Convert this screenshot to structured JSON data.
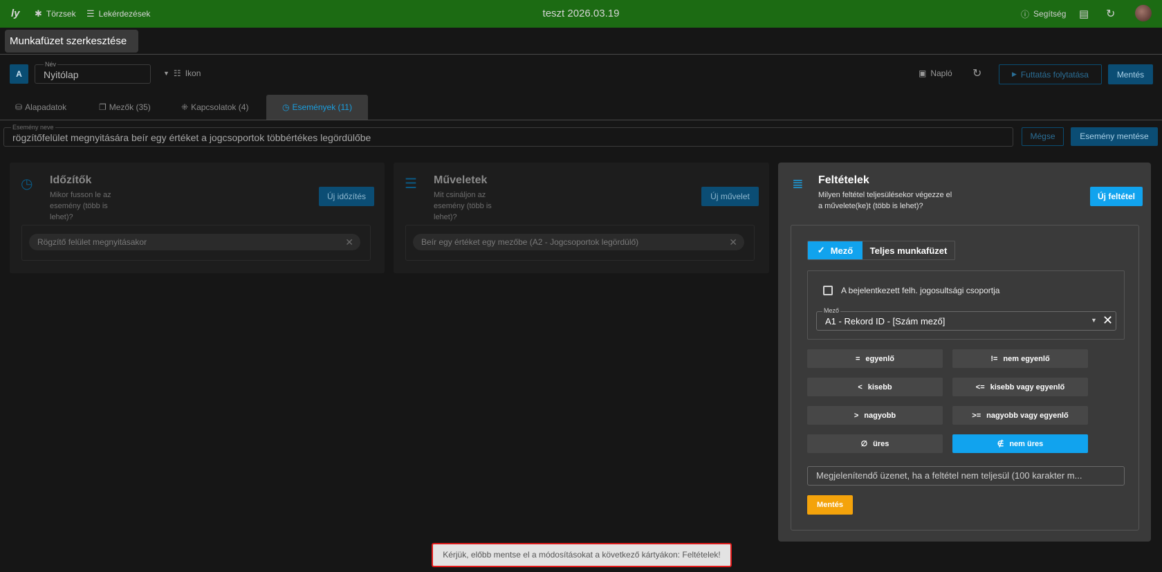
{
  "topbar": {
    "nav": [
      "Törzsek",
      "Lekérdezések"
    ],
    "title": "teszt 2026.03.19",
    "help": "Segítség"
  },
  "page": {
    "title": "Munkafüzet szerkesztése"
  },
  "header": {
    "avatar_letter": "A",
    "name_label": "Név",
    "name_value": "Nyitólap",
    "icon_label": "Ikon",
    "log_label": "Napló",
    "run_label": "Futtatás folytatása",
    "save_label": "Mentés"
  },
  "tabs": [
    {
      "label": "Alapadatok"
    },
    {
      "label": "Mezők (35)"
    },
    {
      "label": "Kapcsolatok (4)"
    },
    {
      "label": "Események (11)"
    }
  ],
  "event": {
    "label": "Esemény neve",
    "value": "rögzítőfelület megnyitására beír egy értéket a jogcsoportok többértékes legördülőbe",
    "cancel": "Mégse",
    "save": "Esemény mentése"
  },
  "timers": {
    "title": "Időzítők",
    "subtitle": "Mikor fusson le az esemény (több is lehet)?",
    "new": "Új időzítés",
    "item": "Rögzítő felület megnyitásakor"
  },
  "actions": {
    "title": "Műveletek",
    "subtitle": "Mit csináljon az esemény (több is lehet)?",
    "new": "Új művelet",
    "item": "Beír egy értéket egy mezőbe  (A2 - Jogcsoportok legördülő)"
  },
  "conditions": {
    "title": "Feltételek",
    "subtitle": "Milyen feltétel teljesülésekor végezze el a művelete(ke)t (több is lehet)?",
    "new": "Új feltétel",
    "scope_field": "Mező",
    "scope_workbook": "Teljes munkafüzet",
    "checkbox_label": "A bejelentkezett felh. jogosultsági csoportja",
    "field_label": "Mező",
    "field_value": "A1 - Rekord ID - [Szám mező]",
    "operators": [
      {
        "sym": "=",
        "label": "egyenlő"
      },
      {
        "sym": "!=",
        "label": "nem egyenlő"
      },
      {
        "sym": "<",
        "label": "kisebb"
      },
      {
        "sym": "<=",
        "label": "kisebb vagy egyenlő"
      },
      {
        "sym": ">",
        "label": "nagyobb"
      },
      {
        "sym": ">=",
        "label": "nagyobb vagy egyenlő"
      },
      {
        "sym": "∅",
        "label": "üres"
      },
      {
        "sym": "∉",
        "label": "nem üres"
      }
    ],
    "active_operator": "nem üres",
    "message_placeholder": "Megjelenítendő üzenet, ha a feltétel nem teljesül (100 karakter m...",
    "save": "Mentés"
  },
  "toast": {
    "text": "Kérjük, előbb mentse el a módosításokat a következő kártyákon: Feltételek!"
  },
  "colors": {
    "topbar": "#1c6b13",
    "accent": "#11a3ee",
    "warn": "#f4a30b",
    "error": "#e11a1a"
  }
}
